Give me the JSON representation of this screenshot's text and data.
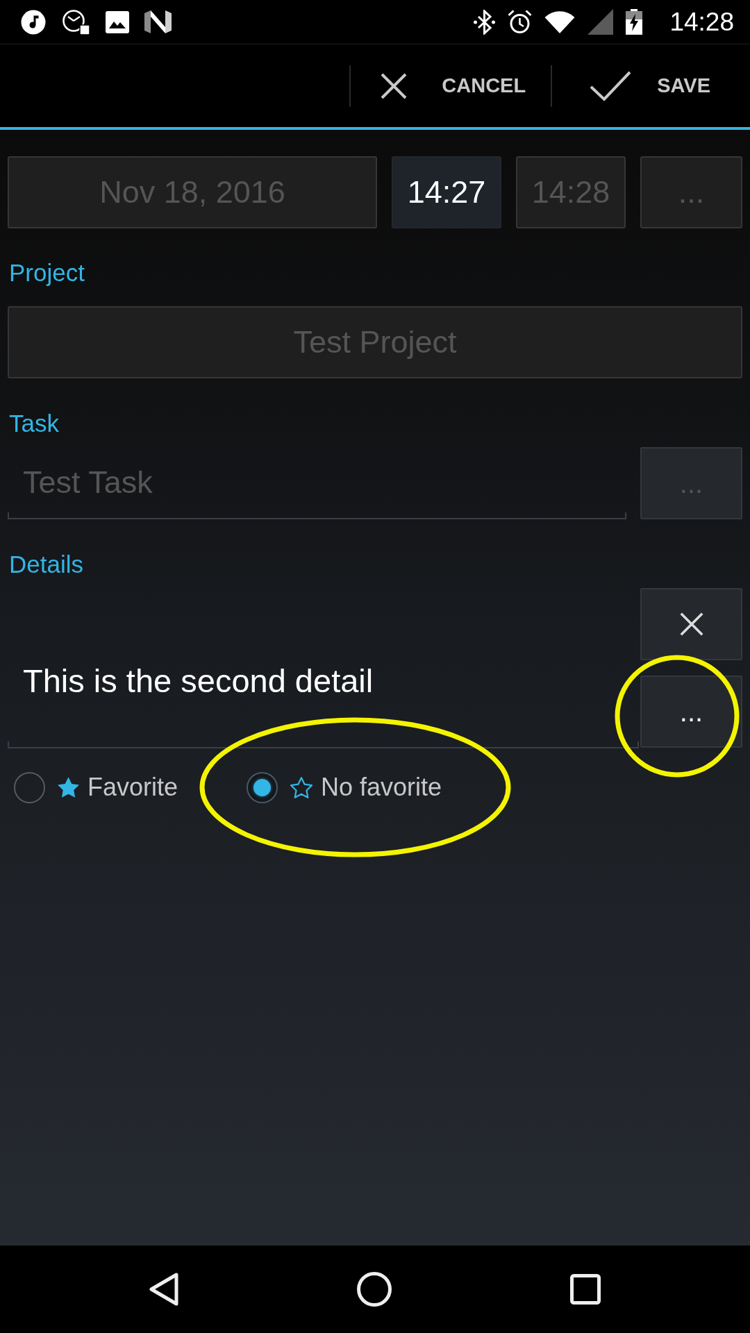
{
  "status_bar": {
    "time": "14:28"
  },
  "action_bar": {
    "buttons": [
      {
        "kind": "cancel",
        "label": "CANCEL"
      },
      {
        "kind": "save",
        "label": "SAVE"
      }
    ]
  },
  "time_row": [
    {
      "kind": "date",
      "text": "Nov 18, 2016",
      "selected": false
    },
    {
      "kind": "time",
      "text": "14:27",
      "selected": true
    },
    {
      "kind": "time",
      "text": "14:28",
      "selected": false
    },
    {
      "kind": "more",
      "text": "...",
      "selected": false
    }
  ],
  "project": {
    "label": "Project",
    "value": "Test Project",
    "disabled": true
  },
  "task": {
    "label": "Task",
    "value": "Test Task",
    "disabled": true,
    "more_button": {
      "text": "...",
      "disabled": true
    }
  },
  "details": {
    "label": "Details",
    "value": "This is the second detail",
    "actions": [
      {
        "kind": "remove",
        "disabled": false,
        "highlighted": false
      },
      {
        "kind": "more",
        "text": "...",
        "disabled": false,
        "highlighted": true
      }
    ]
  },
  "favorite_options": [
    {
      "kind": "filled",
      "label": "Favorite",
      "selected": false,
      "highlighted": false
    },
    {
      "kind": "outline",
      "label": "No favorite",
      "selected": true,
      "highlighted": true
    }
  ]
}
